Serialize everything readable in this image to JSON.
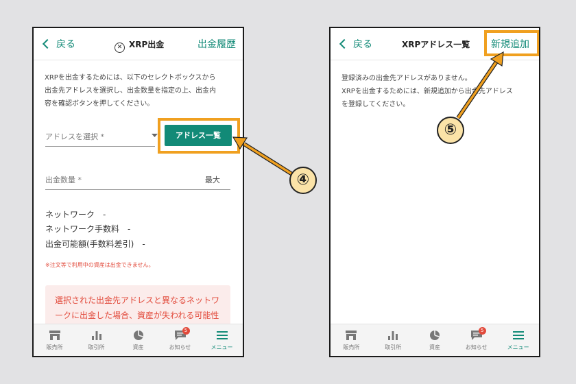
{
  "left": {
    "header": {
      "back_label": "戻る",
      "title": "XRP出金",
      "right_link": "出金履歴"
    },
    "intro_lines": [
      "XRPを出金するためには、以下のセレクトボックスから",
      "出金先アドレスを選択し、出金数量を指定の上、出金内",
      "容を確認ボタンを押してください。"
    ],
    "address_placeholder": "アドレスを選択 *",
    "address_list_button": "アドレス一覧",
    "amount_placeholder": "出金数量 *",
    "max_label": "最大",
    "network_label": "ネットワーク　-",
    "network_fee_label": "ネットワーク手数料　-",
    "withdrawable_label": "出金可能額(手数料差引)　-",
    "warning": "※注文等で利用中の資産は出金できません。",
    "alert_lines": [
      "選択された出金先アドレスと異なるネットワ",
      "ークに出金した場合、資産が失われる可能性"
    ]
  },
  "right": {
    "header": {
      "back_label": "戻る",
      "title": "XRPアドレス一覧",
      "right_link": "新規追加"
    },
    "message_lines": [
      "登録済みの出金先アドレスがありません。",
      "XRPを出金するためには、新規追加から出金先アドレス",
      "を登録してください。"
    ]
  },
  "tabs": [
    {
      "label": "販売所",
      "icon": "store-icon"
    },
    {
      "label": "取引所",
      "icon": "bar-chart-icon"
    },
    {
      "label": "資産",
      "icon": "pie-chart-icon"
    },
    {
      "label": "お知らせ",
      "icon": "message-icon",
      "badge": "5"
    },
    {
      "label": "メニュー",
      "icon": "menu-icon"
    }
  ],
  "annotations": {
    "step4": "④",
    "step5": "⑤"
  },
  "colors": {
    "accent": "#128a77",
    "highlight": "#f0a020",
    "alert": "#e24a3b",
    "callout_fill": "#fbe3a8"
  }
}
